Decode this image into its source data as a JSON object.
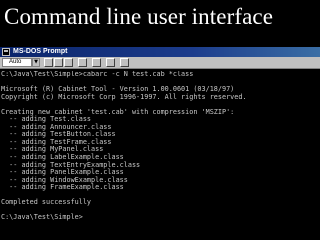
{
  "slide": {
    "title": "Command line user interface"
  },
  "window": {
    "title": "MS-DOS Prompt",
    "font_size_value": "Auto"
  },
  "console": {
    "lines": [
      "C:\\Java\\Test\\Simple>cabarc -c N test.cab *class",
      "",
      "Microsoft (R) Cabinet Tool - Version 1.00.0601 (03/18/97)",
      "Copyright (c) Microsoft Corp 1996-1997. All rights reserved.",
      "",
      "Creating new cabinet 'test.cab' with compression 'MSZIP':",
      "  -- adding Test.class",
      "  -- adding Announcer.class",
      "  -- adding TestButton.class",
      "  -- adding TestFrame.class",
      "  -- adding MyPanel.class",
      "  -- adding LabelExample.class",
      "  -- adding TextEntryExample.class",
      "  -- adding PanelExample.class",
      "  -- adding WindowExample.class",
      "  -- adding FrameExample.class",
      "",
      "Completed successfully",
      "",
      "C:\\Java\\Test\\Simple>"
    ]
  }
}
